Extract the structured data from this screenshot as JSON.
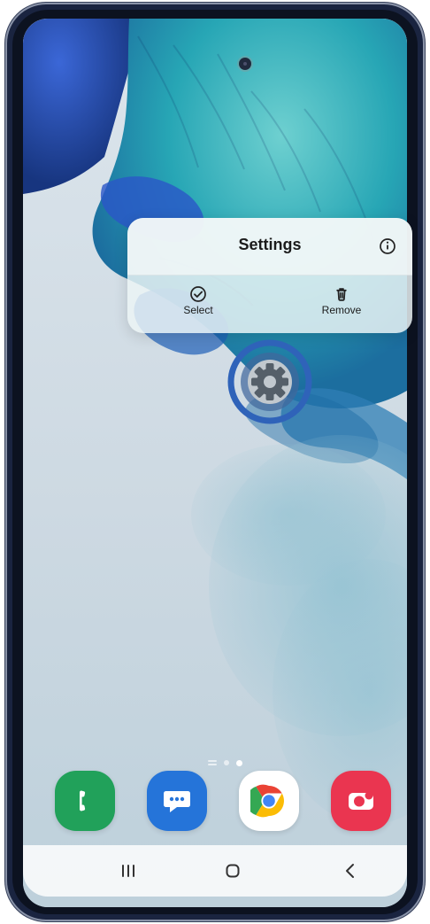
{
  "popup": {
    "title": "Settings",
    "select_label": "Select",
    "remove_label": "Remove"
  },
  "page_indicator": {
    "active_index": 2,
    "total": 3
  },
  "dock": [
    {
      "name": "phone",
      "icon": "phone-icon"
    },
    {
      "name": "messages",
      "icon": "messages-icon"
    },
    {
      "name": "chrome",
      "icon": "chrome-icon"
    },
    {
      "name": "camera",
      "icon": "camera-icon"
    }
  ],
  "navigation": {
    "recent": "recent-apps-icon",
    "home": "home-icon",
    "back": "back-icon"
  },
  "colors": {
    "phone": "#21a15a",
    "messages": "#2574d9",
    "chrome_red": "#ea4335",
    "chrome_green": "#34a853",
    "chrome_yellow": "#fbbc05",
    "chrome_blue": "#4285f4",
    "camera": "#ea3550",
    "focus_ring": "#2f63b9",
    "settings_gear": "#555f69"
  }
}
